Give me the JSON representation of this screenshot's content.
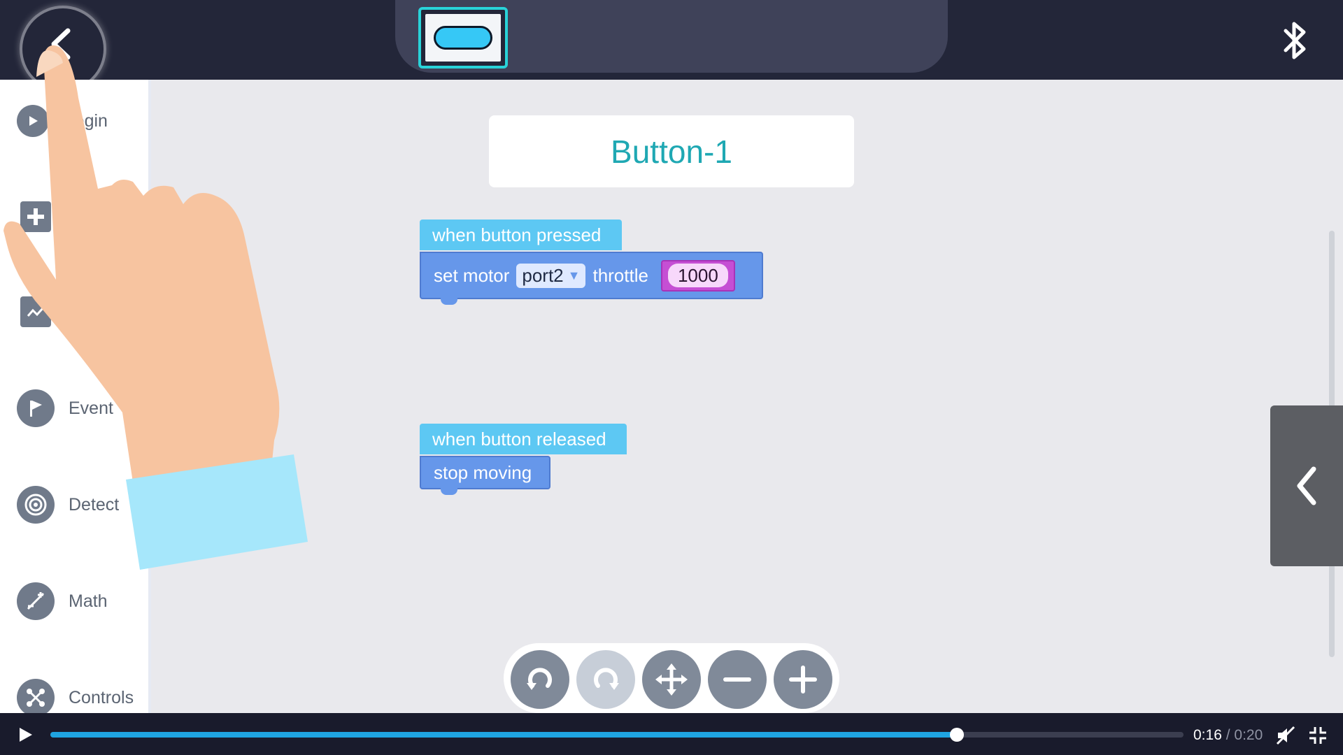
{
  "sidebar": {
    "items": [
      {
        "label": "Begin",
        "icon": "play-circle-icon"
      },
      {
        "label": "",
        "icon": "gamepad-icon"
      },
      {
        "label": "",
        "icon": "chart-icon"
      },
      {
        "label": "Event",
        "icon": "flag-icon"
      },
      {
        "label": "Detect",
        "icon": "radar-icon"
      },
      {
        "label": "Math",
        "icon": "math-icon"
      },
      {
        "label": "Controls",
        "icon": "controls-icon"
      }
    ]
  },
  "workspace": {
    "title": "Button-1",
    "blocks": [
      {
        "hat": "when button pressed",
        "statement": {
          "prefix": "set motor",
          "dropdown": "port2",
          "middle": "throttle",
          "value": "1000"
        }
      },
      {
        "hat": "when button released",
        "statement": {
          "prefix": "stop moving"
        }
      }
    ]
  },
  "toolbar": {
    "buttons": [
      "undo-icon",
      "redo-icon",
      "move-icon",
      "zoom-out-icon",
      "zoom-in-icon"
    ]
  },
  "video": {
    "current_time": "0:16",
    "separator": "/",
    "total_time": "0:20",
    "progress": 0.8
  },
  "colors": {
    "accent": "#29d3d9",
    "hat_block": "#5dc8f3",
    "statement_block": "#6697ea",
    "number_block": "#c54fd4",
    "progress": "#1fa4e1"
  }
}
